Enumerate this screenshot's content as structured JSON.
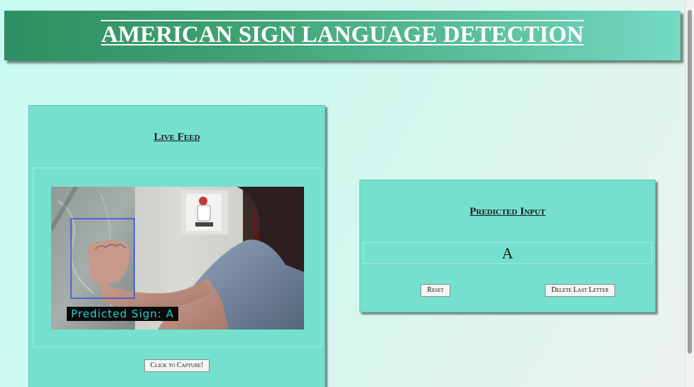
{
  "header": {
    "title": "AMERICAN SIGN LANGUAGE DETECTION"
  },
  "live_feed": {
    "title": "Live Feed",
    "overlay_text": "Predicted Sign: A",
    "capture_button": "Click to Capture!"
  },
  "predicted_input": {
    "title": "Predicted Input",
    "value": "A",
    "reset_button": "Reset",
    "delete_button": "Delete Last Letter"
  },
  "colors": {
    "header_start": "#2f8f62",
    "header_end": "#74dac2",
    "panel": "#76e0cf",
    "overlay_text": "#23d2d2",
    "roi_box": "#3a4fd8"
  }
}
